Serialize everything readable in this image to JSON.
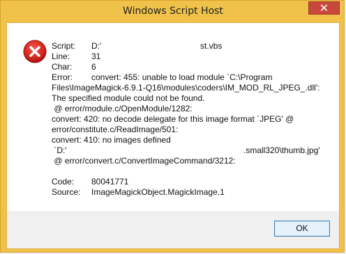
{
  "window": {
    "title": "Windows Script Host",
    "close_glyph": "✕"
  },
  "icons": {
    "error": "error-circle-icon",
    "close": "close-icon"
  },
  "colors": {
    "titlebar": "#f0c24a",
    "close_bg": "#c9483d",
    "error_red": "#d4241d"
  },
  "fields": {
    "script_label": "Script:",
    "script_value_a": "D:'",
    "script_value_b": "st.vbs",
    "line_label": "Line:",
    "line_value": "31",
    "char_label": "Char:",
    "char_value": "6",
    "error_label": "Error:",
    "error_lines": [
      "convert: 455: unable to load module `C:\\Program",
      "Files\\ImageMagick-6.9.1-Q16\\modules\\coders\\IM_MOD_RL_JPEG_.dll':",
      "The specified module could not be found.",
      " @ error/module.c/OpenModule/1282:",
      "convert: 420: no decode delegate for this image format `JPEG' @",
      "error/constitute.c/ReadImage/501:",
      "convert: 410: no images defined",
      " `D:'",
      ".small320\\thumb.jpg'",
      " @ error/convert.c/ConvertImageCommand/3212:"
    ],
    "code_label": "Code:",
    "code_value": "80041771",
    "source_label": "Source:",
    "source_value": "ImageMagickObject.MagickImage.1"
  },
  "footer": {
    "ok_label": "OK"
  }
}
